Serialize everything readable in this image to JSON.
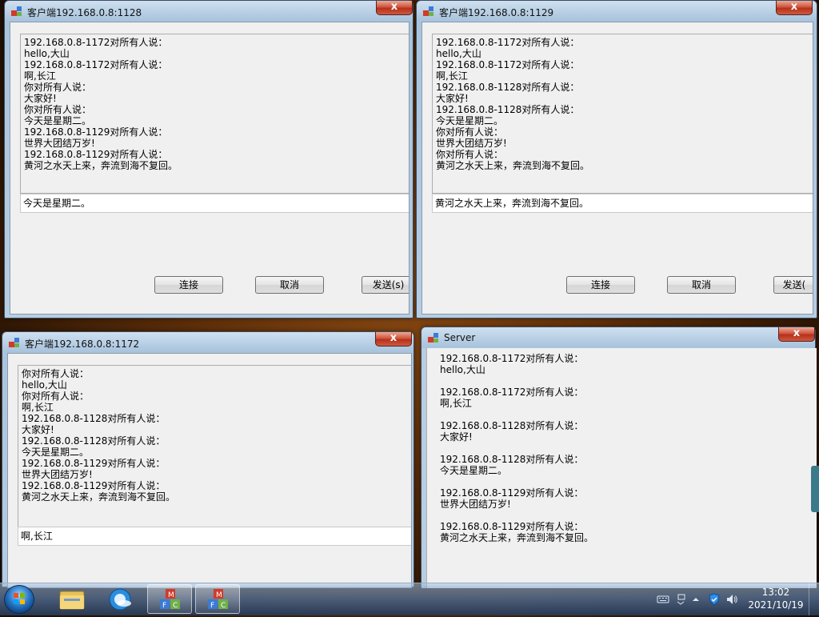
{
  "windows": {
    "client1128": {
      "title": "客户端192.168.0.8:1128",
      "close": "x",
      "log": [
        "192.168.0.8-1172对所有人说：",
        "hello,大山",
        "192.168.0.8-1172对所有人说：",
        "啊,长江",
        "你对所有人说：",
        "大家好!",
        "你对所有人说：",
        "今天是星期二。",
        "192.168.0.8-1129对所有人说：",
        "世界大团结万岁!",
        "192.168.0.8-1129对所有人说：",
        "黄河之水天上来，奔流到海不复回。"
      ],
      "input_value": "今天是星期二。",
      "buttons": {
        "connect": "连接",
        "cancel": "取消",
        "send": "发送(s)"
      }
    },
    "client1129": {
      "title": "客户端192.168.0.8:1129",
      "close": "x",
      "log": [
        "192.168.0.8-1172对所有人说：",
        "hello,大山",
        "192.168.0.8-1172对所有人说：",
        "啊,长江",
        "192.168.0.8-1128对所有人说：",
        "大家好!",
        "192.168.0.8-1128对所有人说：",
        "今天是星期二。",
        "你对所有人说：",
        "世界大团结万岁!",
        "你对所有人说：",
        "黄河之水天上来，奔流到海不复回。"
      ],
      "input_value": "黄河之水天上来，奔流到海不复回。",
      "buttons": {
        "connect": "连接",
        "cancel": "取消",
        "send": "发送("
      }
    },
    "client1172": {
      "title": "客户端192.168.0.8:1172",
      "close": "x",
      "log": [
        "你对所有人说：",
        "hello,大山",
        "你对所有人说：",
        "啊,长江",
        "192.168.0.8-1128对所有人说：",
        "大家好!",
        "192.168.0.8-1128对所有人说：",
        "今天是星期二。",
        "192.168.0.8-1129对所有人说：",
        "世界大团结万岁!",
        "192.168.0.8-1129对所有人说：",
        "黄河之水天上来，奔流到海不复回。"
      ],
      "input_value": "啊,长江"
    },
    "server": {
      "title": "Server",
      "close": "x",
      "messages": [
        {
          "sender": "192.168.0.8-1172对所有人说：",
          "text": "hello,大山"
        },
        {
          "sender": "192.168.0.8-1172对所有人说：",
          "text": "啊,长江"
        },
        {
          "sender": "192.168.0.8-1128对所有人说：",
          "text": "大家好!"
        },
        {
          "sender": "192.168.0.8-1128对所有人说：",
          "text": "今天是星期二。"
        },
        {
          "sender": "192.168.0.8-1129对所有人说：",
          "text": "世界大团结万岁!"
        },
        {
          "sender": "192.168.0.8-1129对所有人说：",
          "text": "黄河之水天上来，奔流到海不复回。"
        }
      ]
    }
  },
  "taskbar": {
    "time": "13:02",
    "date": "2021/10/19",
    "pinned_icons": [
      "start-orb",
      "file-explorer-icon",
      "browser-icon",
      "mfc-app-icon",
      "mfc-app-icon"
    ]
  },
  "colors": {
    "close_red": "#c7452b",
    "window_frame": "#b6cde3"
  }
}
